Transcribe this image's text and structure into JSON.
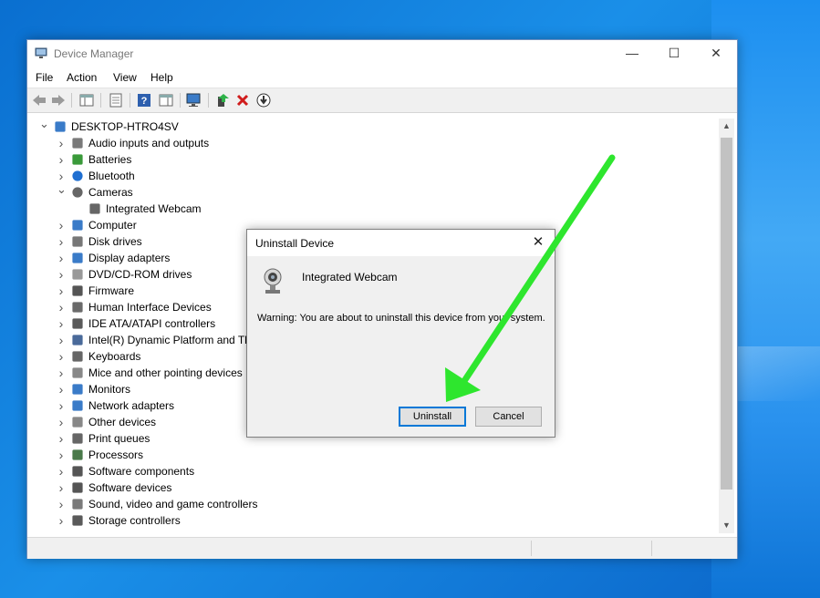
{
  "window": {
    "title": "Device Manager",
    "controls": {
      "minimize": "—",
      "maximize": "☐",
      "close": "✕"
    }
  },
  "menu": [
    "File",
    "Action",
    "View",
    "Help"
  ],
  "toolbar": {
    "icons": [
      "back-arrow-icon",
      "forward-arrow-icon",
      "show-hide-console-tree-icon",
      "properties-icon",
      "help-icon",
      "action-pane-icon",
      "scan-hardware-icon",
      "update-driver-icon",
      "uninstall-device-icon",
      "download-icon"
    ]
  },
  "tree": {
    "root": "DESKTOP-HTRO4SV",
    "items": [
      {
        "label": "Audio inputs and outputs",
        "icon": "speaker-icon",
        "expanded": false
      },
      {
        "label": "Batteries",
        "icon": "battery-icon",
        "expanded": false
      },
      {
        "label": "Bluetooth",
        "icon": "bluetooth-icon",
        "expanded": false
      },
      {
        "label": "Cameras",
        "icon": "camera-icon",
        "expanded": true,
        "children": [
          "Integrated Webcam"
        ]
      },
      {
        "label": "Computer",
        "icon": "monitor-icon",
        "expanded": false
      },
      {
        "label": "Disk drives",
        "icon": "disk-drive-icon",
        "expanded": false
      },
      {
        "label": "Display adapters",
        "icon": "display-adapter-icon",
        "expanded": false
      },
      {
        "label": "DVD/CD-ROM drives",
        "icon": "dvd-icon",
        "expanded": false
      },
      {
        "label": "Firmware",
        "icon": "firmware-icon",
        "expanded": false
      },
      {
        "label": "Human Interface Devices",
        "icon": "hid-icon",
        "expanded": false
      },
      {
        "label": "IDE ATA/ATAPI controllers",
        "icon": "ide-controller-icon",
        "expanded": false
      },
      {
        "label": "Intel(R) Dynamic Platform and Th",
        "icon": "intel-platform-icon",
        "expanded": false
      },
      {
        "label": "Keyboards",
        "icon": "keyboard-icon",
        "expanded": false
      },
      {
        "label": "Mice and other pointing devices",
        "icon": "mouse-icon",
        "expanded": false
      },
      {
        "label": "Monitors",
        "icon": "monitor-icon",
        "expanded": false
      },
      {
        "label": "Network adapters",
        "icon": "network-adapter-icon",
        "expanded": false
      },
      {
        "label": "Other devices",
        "icon": "unknown-device-icon",
        "expanded": false
      },
      {
        "label": "Print queues",
        "icon": "printer-icon",
        "expanded": false
      },
      {
        "label": "Processors",
        "icon": "processor-icon",
        "expanded": false
      },
      {
        "label": "Software components",
        "icon": "software-component-icon",
        "expanded": false
      },
      {
        "label": "Software devices",
        "icon": "software-device-icon",
        "expanded": false
      },
      {
        "label": "Sound, video and game controllers",
        "icon": "speaker-icon",
        "expanded": false
      },
      {
        "label": "Storage controllers",
        "icon": "storage-controller-icon",
        "expanded": false
      }
    ]
  },
  "dialog": {
    "title": "Uninstall Device",
    "device_name": "Integrated Webcam",
    "warning": "Warning: You are about to uninstall this device from your system.",
    "uninstall_label": "Uninstall",
    "cancel_label": "Cancel"
  },
  "colors": {
    "annotation_arrow": "#2ee62e",
    "desktop": "#0a6fd0",
    "accent": "#0078d7"
  }
}
